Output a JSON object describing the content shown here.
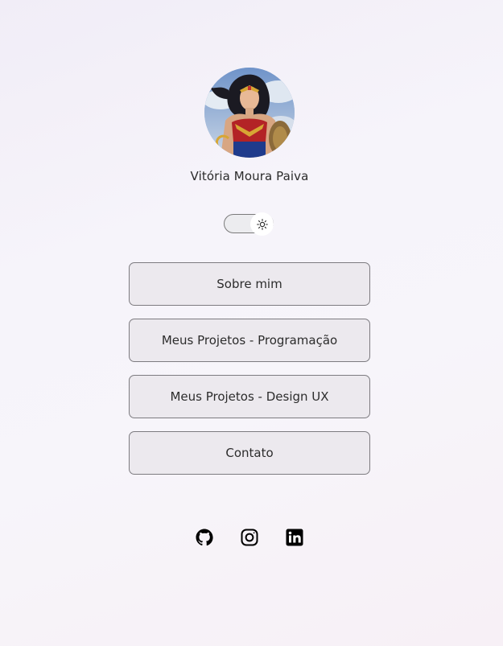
{
  "profile": {
    "name": "Vitória Moura Paiva",
    "avatar_icon": "profile-photo"
  },
  "theme_toggle": {
    "icon": "sun-icon",
    "state": "light"
  },
  "links": [
    {
      "label": "Sobre mim"
    },
    {
      "label": "Meus Projetos - Programação"
    },
    {
      "label": "Meus Projetos - Design UX"
    },
    {
      "label": "Contato"
    }
  ],
  "socials": [
    {
      "icon": "github-icon"
    },
    {
      "icon": "instagram-icon"
    },
    {
      "icon": "linkedin-icon"
    }
  ],
  "colors": {
    "background": "#f5f2f8",
    "button_bg": "#ece9ee",
    "button_border": "#7d7b80",
    "text": "#2c2c2c"
  }
}
